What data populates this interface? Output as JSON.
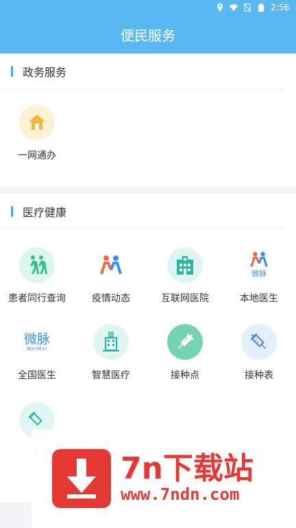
{
  "status_bar": {
    "time": "2:56"
  },
  "header": {
    "title": "便民服务"
  },
  "sections": [
    {
      "title": "政务服务",
      "items": [
        {
          "label": "一网通办",
          "icon": "home-icon"
        }
      ]
    },
    {
      "title": "医疗健康",
      "items": [
        {
          "label": "患者同行查询",
          "icon": "walking-people-icon"
        },
        {
          "label": "疫情动态",
          "icon": "weimai-people-icon"
        },
        {
          "label": "互联网医院",
          "icon": "hospital-icon"
        },
        {
          "label": "本地医生",
          "icon": "weimai-logo-icon"
        },
        {
          "label": "全国医生",
          "icon": "weimai-text-icon"
        },
        {
          "label": "智慧医疗",
          "icon": "hospital-building-icon"
        },
        {
          "label": "接种点",
          "icon": "syringe-icon"
        },
        {
          "label": "接种表",
          "icon": "syringe-outline-icon"
        },
        {
          "label": "/",
          "icon": "partial-icon"
        }
      ]
    }
  ],
  "weimai": {
    "cn": "微脉",
    "en": "WeiMai"
  },
  "watermark": {
    "title": "7n下载站",
    "url": "www.7ndn.com"
  },
  "colors": {
    "header": "#5ab9f2",
    "accent": "#3aa6ee",
    "watermark": "#e53935"
  }
}
